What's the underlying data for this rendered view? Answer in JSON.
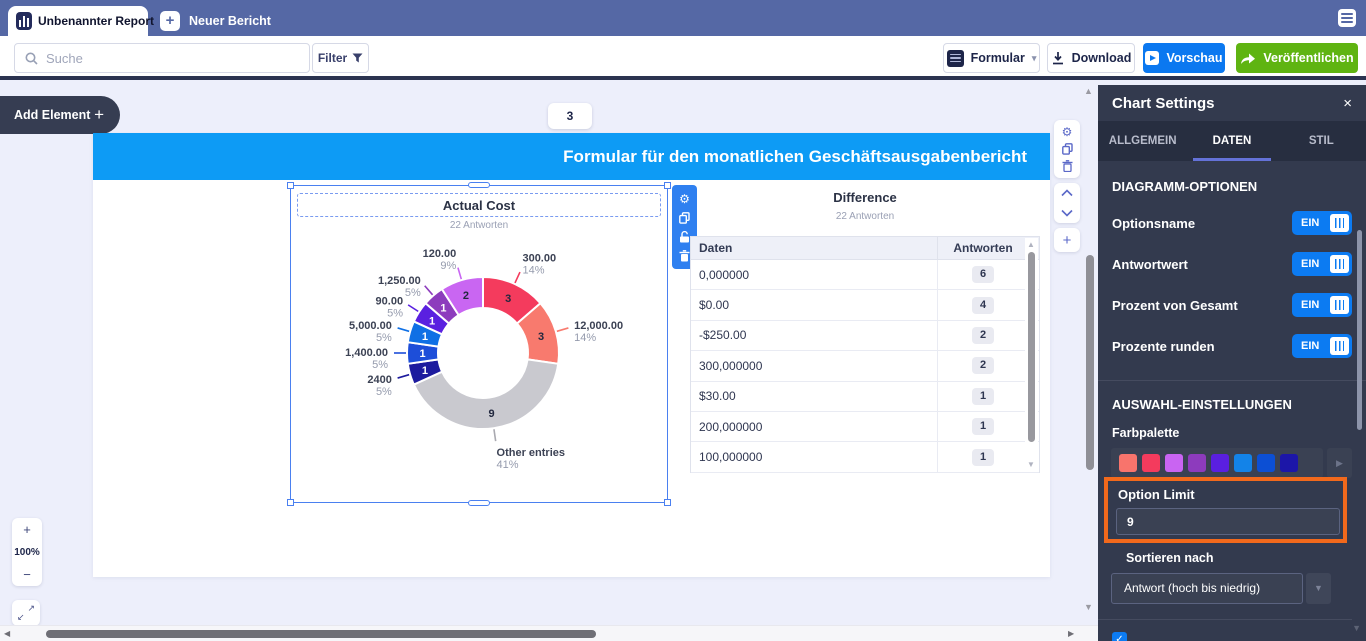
{
  "topbar": {
    "active_tab": "Unbenannter Report",
    "new_tab": "Neuer Bericht"
  },
  "toolbar": {
    "search_placeholder": "Suche",
    "filter": "Filter",
    "formular": "Formular",
    "download": "Download",
    "vorschau": "Vorschau",
    "veroeffentlichen": "Veröffentlichen"
  },
  "canvas": {
    "add_element": "Add Element",
    "page_number": "3",
    "page_title": "Formular für den monatlichen Geschäftsausgabenbericht",
    "zoom_level": "100%"
  },
  "chart_data": {
    "type": "donut",
    "title": "Actual Cost",
    "subtitle": "22 Antworten",
    "total": 22,
    "segments": [
      {
        "label": "300.00",
        "count": 3,
        "pct": "14%",
        "color": "#f43b5d",
        "count_color": "#22283f"
      },
      {
        "label": "12,000.00",
        "count": 3,
        "pct": "14%",
        "color": "#f87a6e",
        "count_color": "#22283f"
      },
      {
        "label": "Other entries",
        "count": 9,
        "pct": "41%",
        "color": "#c9c9cf",
        "count_color": "#22283f",
        "line_color": "#a9a9b0"
      },
      {
        "label": "2400",
        "count": 1,
        "pct": "5%",
        "color": "#1d1b9e",
        "count_color": "#ffffff"
      },
      {
        "label": "1,400.00",
        "count": 1,
        "pct": "5%",
        "color": "#1d4ed9",
        "count_color": "#ffffff"
      },
      {
        "label": "5,000.00",
        "count": 1,
        "pct": "5%",
        "color": "#0f70e5",
        "count_color": "#ffffff"
      },
      {
        "label": "90.00",
        "count": 1,
        "pct": "5%",
        "color": "#5a20e0",
        "count_color": "#ffffff"
      },
      {
        "label": "1,250.00",
        "count": 1,
        "pct": "5%",
        "color": "#8d3cbd",
        "count_color": "#ffffff"
      },
      {
        "label": "120.00",
        "count": 2,
        "pct": "9%",
        "color": "#c966f2",
        "count_color": "#22283f"
      }
    ]
  },
  "table_widget": {
    "title": "Difference",
    "subtitle": "22 Antworten",
    "columns": [
      "Daten",
      "Antworten"
    ],
    "rows": [
      {
        "daten": "0,000000",
        "antworten": "6"
      },
      {
        "daten": "$0.00",
        "antworten": "4"
      },
      {
        "daten": "-$250.00",
        "antworten": "2"
      },
      {
        "daten": "300,000000",
        "antworten": "2"
      },
      {
        "daten": "$30.00",
        "antworten": "1"
      },
      {
        "daten": "200,000000",
        "antworten": "1"
      },
      {
        "daten": "100,000000",
        "antworten": "1"
      }
    ]
  },
  "panel": {
    "title": "Chart Settings",
    "tabs": [
      {
        "label": "ALLGEMEIN",
        "active": false
      },
      {
        "label": "DATEN",
        "active": true
      },
      {
        "label": "STIL",
        "active": false
      }
    ],
    "section_diagram": "DIAGRAMM-OPTIONEN",
    "toggles": [
      {
        "label": "Optionsname",
        "state": "EIN"
      },
      {
        "label": "Antwortwert",
        "state": "EIN"
      },
      {
        "label": "Prozent von Gesamt",
        "state": "EIN"
      },
      {
        "label": "Prozente runden",
        "state": "EIN"
      }
    ],
    "section_selection": "AUSWAHL-EINSTELLUNGEN",
    "farbpalette_label": "Farbpalette",
    "palette": [
      "#f8746c",
      "#f43b5d",
      "#c964f2",
      "#8d3bbd",
      "#5a1fe0",
      "#1383e8",
      "#0c4fd4",
      "#1c16a8"
    ],
    "option_limit_label": "Option Limit",
    "option_limit_value": "9",
    "sort_label": "Sortieren nach",
    "sort_value": "Antwort (hoch bis niedrig)",
    "accent_orange": "#f2691c",
    "toggle_color": "#0c7bf2"
  }
}
